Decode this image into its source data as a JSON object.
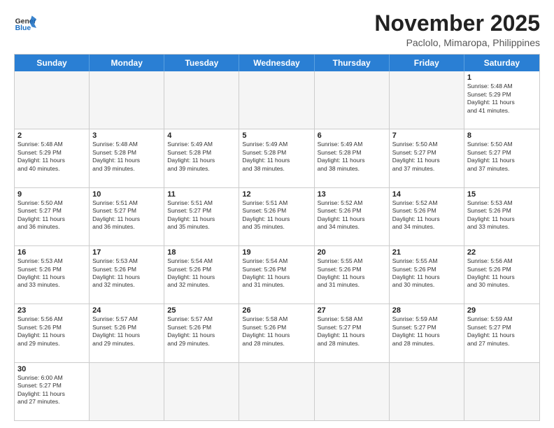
{
  "header": {
    "logo_general": "General",
    "logo_blue": "Blue",
    "month_title": "November 2025",
    "location": "Paclolo, Mimaropa, Philippines"
  },
  "days_of_week": [
    "Sunday",
    "Monday",
    "Tuesday",
    "Wednesday",
    "Thursday",
    "Friday",
    "Saturday"
  ],
  "weeks": [
    [
      {
        "day": "",
        "content": ""
      },
      {
        "day": "",
        "content": ""
      },
      {
        "day": "",
        "content": ""
      },
      {
        "day": "",
        "content": ""
      },
      {
        "day": "",
        "content": ""
      },
      {
        "day": "",
        "content": ""
      },
      {
        "day": "1",
        "content": "Sunrise: 5:48 AM\nSunset: 5:29 PM\nDaylight: 11 hours\nand 41 minutes."
      }
    ],
    [
      {
        "day": "2",
        "content": "Sunrise: 5:48 AM\nSunset: 5:29 PM\nDaylight: 11 hours\nand 40 minutes."
      },
      {
        "day": "3",
        "content": "Sunrise: 5:48 AM\nSunset: 5:28 PM\nDaylight: 11 hours\nand 39 minutes."
      },
      {
        "day": "4",
        "content": "Sunrise: 5:49 AM\nSunset: 5:28 PM\nDaylight: 11 hours\nand 39 minutes."
      },
      {
        "day": "5",
        "content": "Sunrise: 5:49 AM\nSunset: 5:28 PM\nDaylight: 11 hours\nand 38 minutes."
      },
      {
        "day": "6",
        "content": "Sunrise: 5:49 AM\nSunset: 5:28 PM\nDaylight: 11 hours\nand 38 minutes."
      },
      {
        "day": "7",
        "content": "Sunrise: 5:50 AM\nSunset: 5:27 PM\nDaylight: 11 hours\nand 37 minutes."
      },
      {
        "day": "8",
        "content": "Sunrise: 5:50 AM\nSunset: 5:27 PM\nDaylight: 11 hours\nand 37 minutes."
      }
    ],
    [
      {
        "day": "9",
        "content": "Sunrise: 5:50 AM\nSunset: 5:27 PM\nDaylight: 11 hours\nand 36 minutes."
      },
      {
        "day": "10",
        "content": "Sunrise: 5:51 AM\nSunset: 5:27 PM\nDaylight: 11 hours\nand 36 minutes."
      },
      {
        "day": "11",
        "content": "Sunrise: 5:51 AM\nSunset: 5:27 PM\nDaylight: 11 hours\nand 35 minutes."
      },
      {
        "day": "12",
        "content": "Sunrise: 5:51 AM\nSunset: 5:26 PM\nDaylight: 11 hours\nand 35 minutes."
      },
      {
        "day": "13",
        "content": "Sunrise: 5:52 AM\nSunset: 5:26 PM\nDaylight: 11 hours\nand 34 minutes."
      },
      {
        "day": "14",
        "content": "Sunrise: 5:52 AM\nSunset: 5:26 PM\nDaylight: 11 hours\nand 34 minutes."
      },
      {
        "day": "15",
        "content": "Sunrise: 5:53 AM\nSunset: 5:26 PM\nDaylight: 11 hours\nand 33 minutes."
      }
    ],
    [
      {
        "day": "16",
        "content": "Sunrise: 5:53 AM\nSunset: 5:26 PM\nDaylight: 11 hours\nand 33 minutes."
      },
      {
        "day": "17",
        "content": "Sunrise: 5:53 AM\nSunset: 5:26 PM\nDaylight: 11 hours\nand 32 minutes."
      },
      {
        "day": "18",
        "content": "Sunrise: 5:54 AM\nSunset: 5:26 PM\nDaylight: 11 hours\nand 32 minutes."
      },
      {
        "day": "19",
        "content": "Sunrise: 5:54 AM\nSunset: 5:26 PM\nDaylight: 11 hours\nand 31 minutes."
      },
      {
        "day": "20",
        "content": "Sunrise: 5:55 AM\nSunset: 5:26 PM\nDaylight: 11 hours\nand 31 minutes."
      },
      {
        "day": "21",
        "content": "Sunrise: 5:55 AM\nSunset: 5:26 PM\nDaylight: 11 hours\nand 30 minutes."
      },
      {
        "day": "22",
        "content": "Sunrise: 5:56 AM\nSunset: 5:26 PM\nDaylight: 11 hours\nand 30 minutes."
      }
    ],
    [
      {
        "day": "23",
        "content": "Sunrise: 5:56 AM\nSunset: 5:26 PM\nDaylight: 11 hours\nand 29 minutes."
      },
      {
        "day": "24",
        "content": "Sunrise: 5:57 AM\nSunset: 5:26 PM\nDaylight: 11 hours\nand 29 minutes."
      },
      {
        "day": "25",
        "content": "Sunrise: 5:57 AM\nSunset: 5:26 PM\nDaylight: 11 hours\nand 29 minutes."
      },
      {
        "day": "26",
        "content": "Sunrise: 5:58 AM\nSunset: 5:26 PM\nDaylight: 11 hours\nand 28 minutes."
      },
      {
        "day": "27",
        "content": "Sunrise: 5:58 AM\nSunset: 5:27 PM\nDaylight: 11 hours\nand 28 minutes."
      },
      {
        "day": "28",
        "content": "Sunrise: 5:59 AM\nSunset: 5:27 PM\nDaylight: 11 hours\nand 28 minutes."
      },
      {
        "day": "29",
        "content": "Sunrise: 5:59 AM\nSunset: 5:27 PM\nDaylight: 11 hours\nand 27 minutes."
      }
    ],
    [
      {
        "day": "30",
        "content": "Sunrise: 6:00 AM\nSunset: 5:27 PM\nDaylight: 11 hours\nand 27 minutes."
      },
      {
        "day": "",
        "content": ""
      },
      {
        "day": "",
        "content": ""
      },
      {
        "day": "",
        "content": ""
      },
      {
        "day": "",
        "content": ""
      },
      {
        "day": "",
        "content": ""
      },
      {
        "day": "",
        "content": ""
      }
    ]
  ]
}
